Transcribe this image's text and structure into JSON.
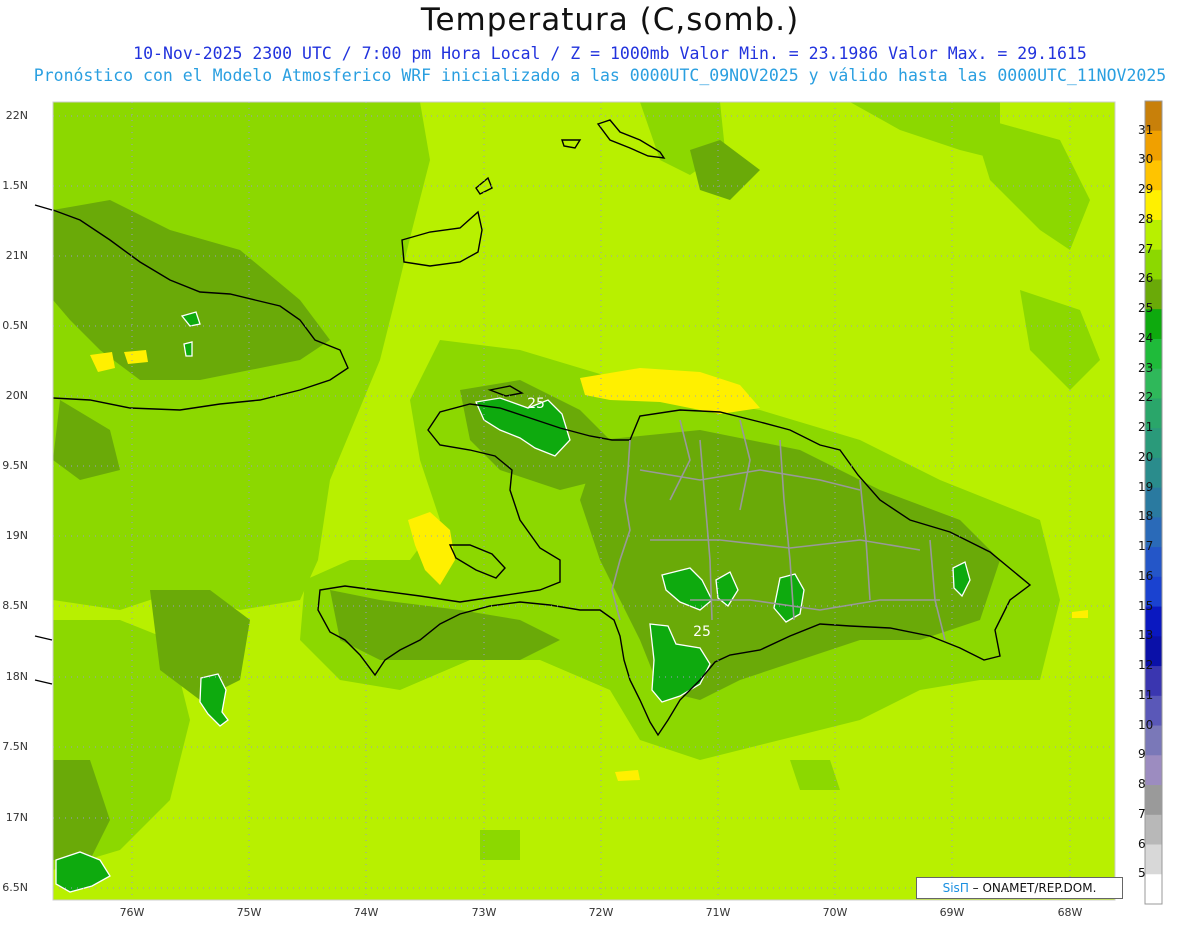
{
  "title": "Temperatura (C,somb.)",
  "subtitle_line1": "10-Nov-2025  2300 UTC / 7:00 pm Hora Local / Z = 1000mb   Valor Min. = 23.1986  Valor Max. = 29.1615",
  "subtitle_line2": "Pronóstico con el Modelo Atmosferico WRF inicializado a las 0000UTC_09NOV2025 y válido hasta las  0000UTC_11NOV2025",
  "lat_labels": [
    "22N",
    "1.5N",
    "21N",
    "0.5N",
    "20N",
    "9.5N",
    "19N",
    "8.5N",
    "18N",
    "7.5N",
    "17N",
    "6.5N"
  ],
  "lon_labels": [
    "76W",
    "75W",
    "74W",
    "73W",
    "72W",
    "71W",
    "70W",
    "69W",
    "68W"
  ],
  "contour_labels": [
    "25",
    "25"
  ],
  "colorbar": {
    "labels": [
      "31",
      "30",
      "29",
      "28",
      "27",
      "26",
      "25",
      "24",
      "23",
      "22",
      "21",
      "20",
      "19",
      "18",
      "17",
      "16",
      "15",
      "13",
      "12",
      "11",
      "10",
      "9",
      "8",
      "7",
      "6",
      "5"
    ],
    "colors": [
      "#c8800a",
      "#f0a000",
      "#ffc400",
      "#fff000",
      "#b8f000",
      "#8cd800",
      "#6aaa08",
      "#0eaa0e",
      "#1fbb3a",
      "#2fb85a",
      "#2aa66a",
      "#2a9a7a",
      "#2a8c8c",
      "#2a7aa0",
      "#2a6ab8",
      "#2456c8",
      "#1a42d0",
      "#0a18c0",
      "#0a10a8",
      "#3a36b0",
      "#5a58b8",
      "#7a78b8",
      "#9c8cc0",
      "#9a9a9a",
      "#b8b8b8",
      "#d8d8d8",
      "#ffffff"
    ]
  },
  "credit": {
    "logo": "SisΠ",
    "text": "– ONAMET/REP.DOM."
  }
}
